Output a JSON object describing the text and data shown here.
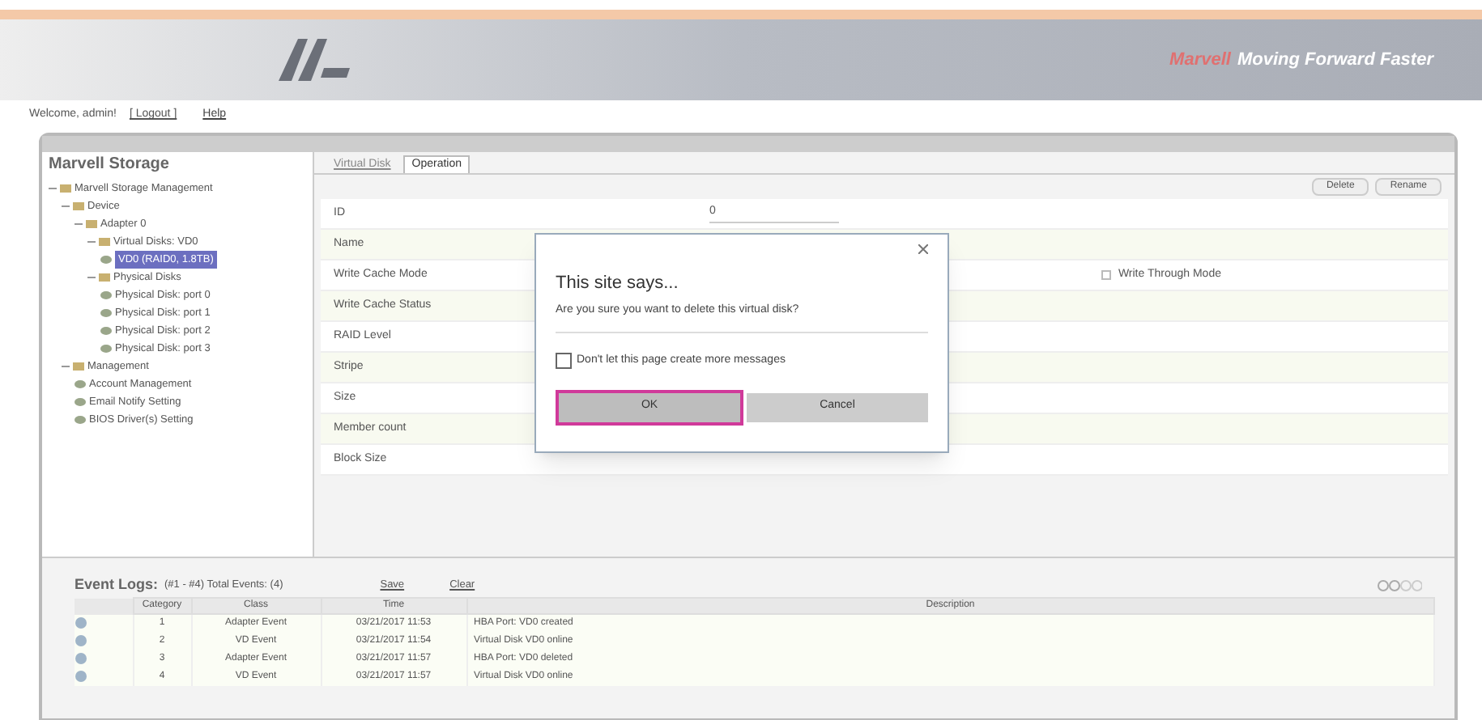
{
  "header": {
    "brand": "Marvell",
    "tagline": "Moving Forward Faster"
  },
  "nav": {
    "welcome": "Welcome, admin!",
    "logout": "[ Logout ]",
    "help": "Help"
  },
  "app_title": "Marvell Storage",
  "tree": [
    {
      "label": "Marvell Storage Management",
      "selected": false,
      "children": [
        {
          "label": "Device",
          "selected": false,
          "children": [
            {
              "label": "Adapter 0",
              "selected": false,
              "children": [
                {
                  "label": "Virtual Disks: VD0",
                  "selected": false,
                  "children": [
                    {
                      "label": "VD0 (RAID0, 1.8TB)",
                      "selected": true
                    }
                  ]
                },
                {
                  "label": "Physical Disks",
                  "selected": false,
                  "children": [
                    {
                      "label": "Physical Disk: port 0",
                      "selected": false
                    },
                    {
                      "label": "Physical Disk: port 1",
                      "selected": false
                    },
                    {
                      "label": "Physical Disk: port 2",
                      "selected": false
                    },
                    {
                      "label": "Physical Disk: port 3",
                      "selected": false
                    }
                  ]
                }
              ]
            }
          ]
        },
        {
          "label": "Management",
          "selected": false,
          "children": [
            {
              "label": "Account Management",
              "selected": false
            },
            {
              "label": "Email Notify Setting",
              "selected": false
            },
            {
              "label": "BIOS Driver(s) Setting",
              "selected": false
            }
          ]
        }
      ]
    }
  ],
  "tabs": [
    {
      "label": "Virtual Disk",
      "selected": false
    },
    {
      "label": "Operation",
      "selected": true
    }
  ],
  "toolbar_buttons": [
    "Delete",
    "Rename"
  ],
  "properties": [
    {
      "label": "ID",
      "value": "0"
    },
    {
      "label": "Name"
    },
    {
      "label": "Write Cache Mode"
    },
    {
      "label": "Write Cache Status"
    },
    {
      "label": "RAID Level"
    },
    {
      "label": "Stripe"
    },
    {
      "label": "Size"
    },
    {
      "label": "Member count"
    },
    {
      "label": "Block Size"
    }
  ],
  "option": {
    "label": "Write Through Mode",
    "checked": false
  },
  "dialog": {
    "title": "This site says...",
    "message": "Are you sure you want to delete this virtual disk?",
    "checkbox": {
      "label": "Don't let this page create more messages",
      "checked": false
    },
    "buttons": [
      {
        "label": "OK",
        "selected": true
      },
      {
        "label": "Cancel",
        "selected": false
      }
    ]
  },
  "event_logs": {
    "title": "Event Logs:",
    "summary": "(#1 - #4) Total Events: (4)",
    "buttons": [
      "Save",
      "Clear"
    ],
    "columns": [
      "Category",
      "Class",
      "Time",
      "Description"
    ],
    "rows": [
      [
        "1",
        "Adapter Event",
        "03/21/2017 11:53",
        "HBA Port: VD0 created"
      ],
      [
        "2",
        "VD Event",
        "03/21/2017 11:54",
        "Virtual Disk VD0 online"
      ],
      [
        "3",
        "Adapter Event",
        "03/21/2017 11:57",
        "HBA Port: VD0 deleted"
      ],
      [
        "4",
        "VD Event",
        "03/21/2017 11:57",
        "Virtual Disk VD0 online"
      ]
    ]
  }
}
